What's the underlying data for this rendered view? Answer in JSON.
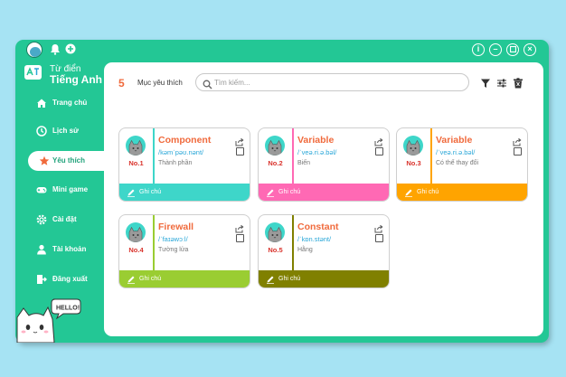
{
  "app": {
    "brand_line1": "Từ điển",
    "brand_line2": "Tiếng Anh",
    "accent_color": "#23c795"
  },
  "topbar": {
    "icons": [
      "avatar",
      "bell-icon",
      "plus-circle-icon"
    ],
    "window_controls": [
      "info-icon",
      "minimize-icon",
      "maximize-icon",
      "close-icon"
    ]
  },
  "sidebar": {
    "items": [
      {
        "label": "Trang chủ",
        "icon": "home-icon",
        "active": false
      },
      {
        "label": "Lịch sử",
        "icon": "history-icon",
        "active": false
      },
      {
        "label": "Yêu thích",
        "icon": "star-icon",
        "active": true
      },
      {
        "label": "Mini game",
        "icon": "gamepad-icon",
        "active": false
      },
      {
        "label": "Cài đặt",
        "icon": "gear-icon",
        "active": false
      },
      {
        "label": "Tài khoản",
        "icon": "user-icon",
        "active": false
      },
      {
        "label": "Đăng xuất",
        "icon": "logout-icon",
        "active": false
      }
    ],
    "mascot_text": "HELLO!"
  },
  "main": {
    "count": "5",
    "section_title": "Mục yêu thích",
    "search": {
      "placeholder": "Tìm kiếm...",
      "value": ""
    },
    "tools": [
      "filter-icon",
      "sliders-icon",
      "trash-icon"
    ]
  },
  "cards": [
    {
      "num": "No.1",
      "word": "Component",
      "ipa": "/kəmˈpəʊ.nənt/",
      "meaning": "Thành phần",
      "note": "Ghi chú",
      "color": "#3ed6c9",
      "word_color": "#f06a3c"
    },
    {
      "num": "No.2",
      "word": "Variable",
      "ipa": "/ˈveə.ri.ə.bəl/",
      "meaning": "Biến",
      "note": "Ghi chú",
      "color": "#ff69b4",
      "word_color": "#f06a3c"
    },
    {
      "num": "No.3",
      "word": "Variable",
      "ipa": "/ˈveə.ri.ə.bəl/",
      "meaning": "Có thể thay đổi",
      "note": "Ghi chú",
      "color": "#ffa400",
      "word_color": "#f06a3c"
    },
    {
      "num": "No.4",
      "word": "Firewall",
      "ipa": "/ˈfaɪəwɔːl/",
      "meaning": "Tường lửa",
      "note": "Ghi chú",
      "color": "#9acd32",
      "word_color": "#f06a3c"
    },
    {
      "num": "No.5",
      "word": "Constant",
      "ipa": "/ˈkɒn.stənt/",
      "meaning": "Hằng",
      "note": "Ghi chú",
      "color": "#808000",
      "word_color": "#f06a3c"
    }
  ]
}
